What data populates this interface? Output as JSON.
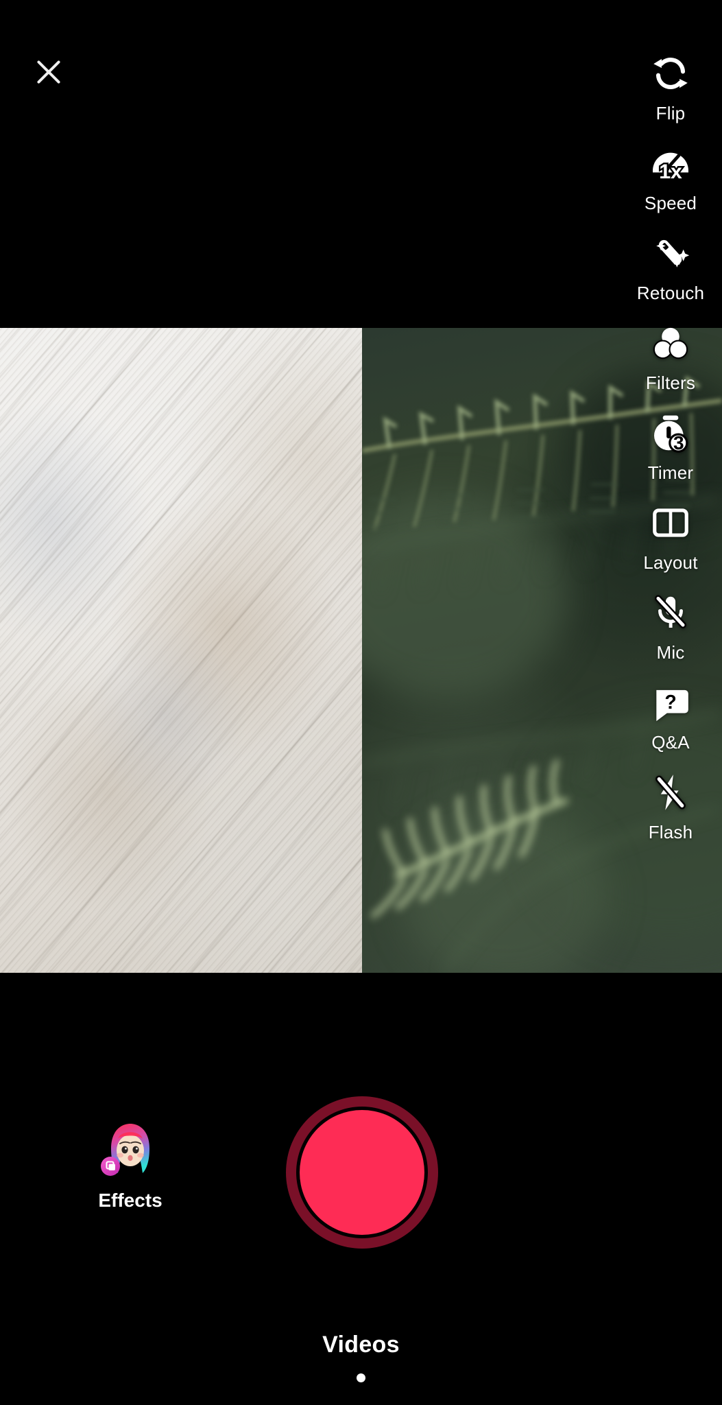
{
  "app": {
    "name": "Camera",
    "background_color": "#000000"
  },
  "header": {
    "close": {
      "icon": "close-icon",
      "label": ""
    }
  },
  "preview": {
    "layout_mode": "split-vertical-2",
    "panes": [
      {
        "id": "left",
        "subject": "light wood grain surface",
        "dominant_color": "#ebe8e3"
      },
      {
        "id": "right",
        "subject": "dark green fern foliage",
        "dominant_color": "#2e3c30"
      }
    ]
  },
  "tool_rail": {
    "items": [
      {
        "id": "flip",
        "label": "Flip",
        "icon": "flip-camera-icon"
      },
      {
        "id": "speed",
        "label": "Speed",
        "icon": "speedometer-icon",
        "value": "1x"
      },
      {
        "id": "retouch",
        "label": "Retouch",
        "icon": "magic-wand-icon"
      },
      {
        "id": "filters",
        "label": "Filters",
        "icon": "filters-circles-icon"
      },
      {
        "id": "timer",
        "label": "Timer",
        "icon": "stopwatch-icon",
        "value": "3"
      },
      {
        "id": "layout",
        "label": "Layout",
        "icon": "layout-split-icon"
      },
      {
        "id": "mic",
        "label": "Mic",
        "icon": "mic-muted-icon",
        "state": "off"
      },
      {
        "id": "qa",
        "label": "Q&A",
        "icon": "question-bubble-icon"
      },
      {
        "id": "flash",
        "label": "Flash",
        "icon": "flash-off-icon",
        "state": "off"
      }
    ]
  },
  "bottom_bar": {
    "effects": {
      "label": "Effects",
      "icon": "effects-avatar-icon"
    },
    "record": {
      "label": "",
      "icon": "record-button",
      "fill_color": "#fe2c55",
      "ring_color": "#7a1028",
      "state": "idle"
    },
    "mode": {
      "selected": "Videos",
      "page_indicator_count": 1,
      "page_indicator_active": 0
    }
  }
}
